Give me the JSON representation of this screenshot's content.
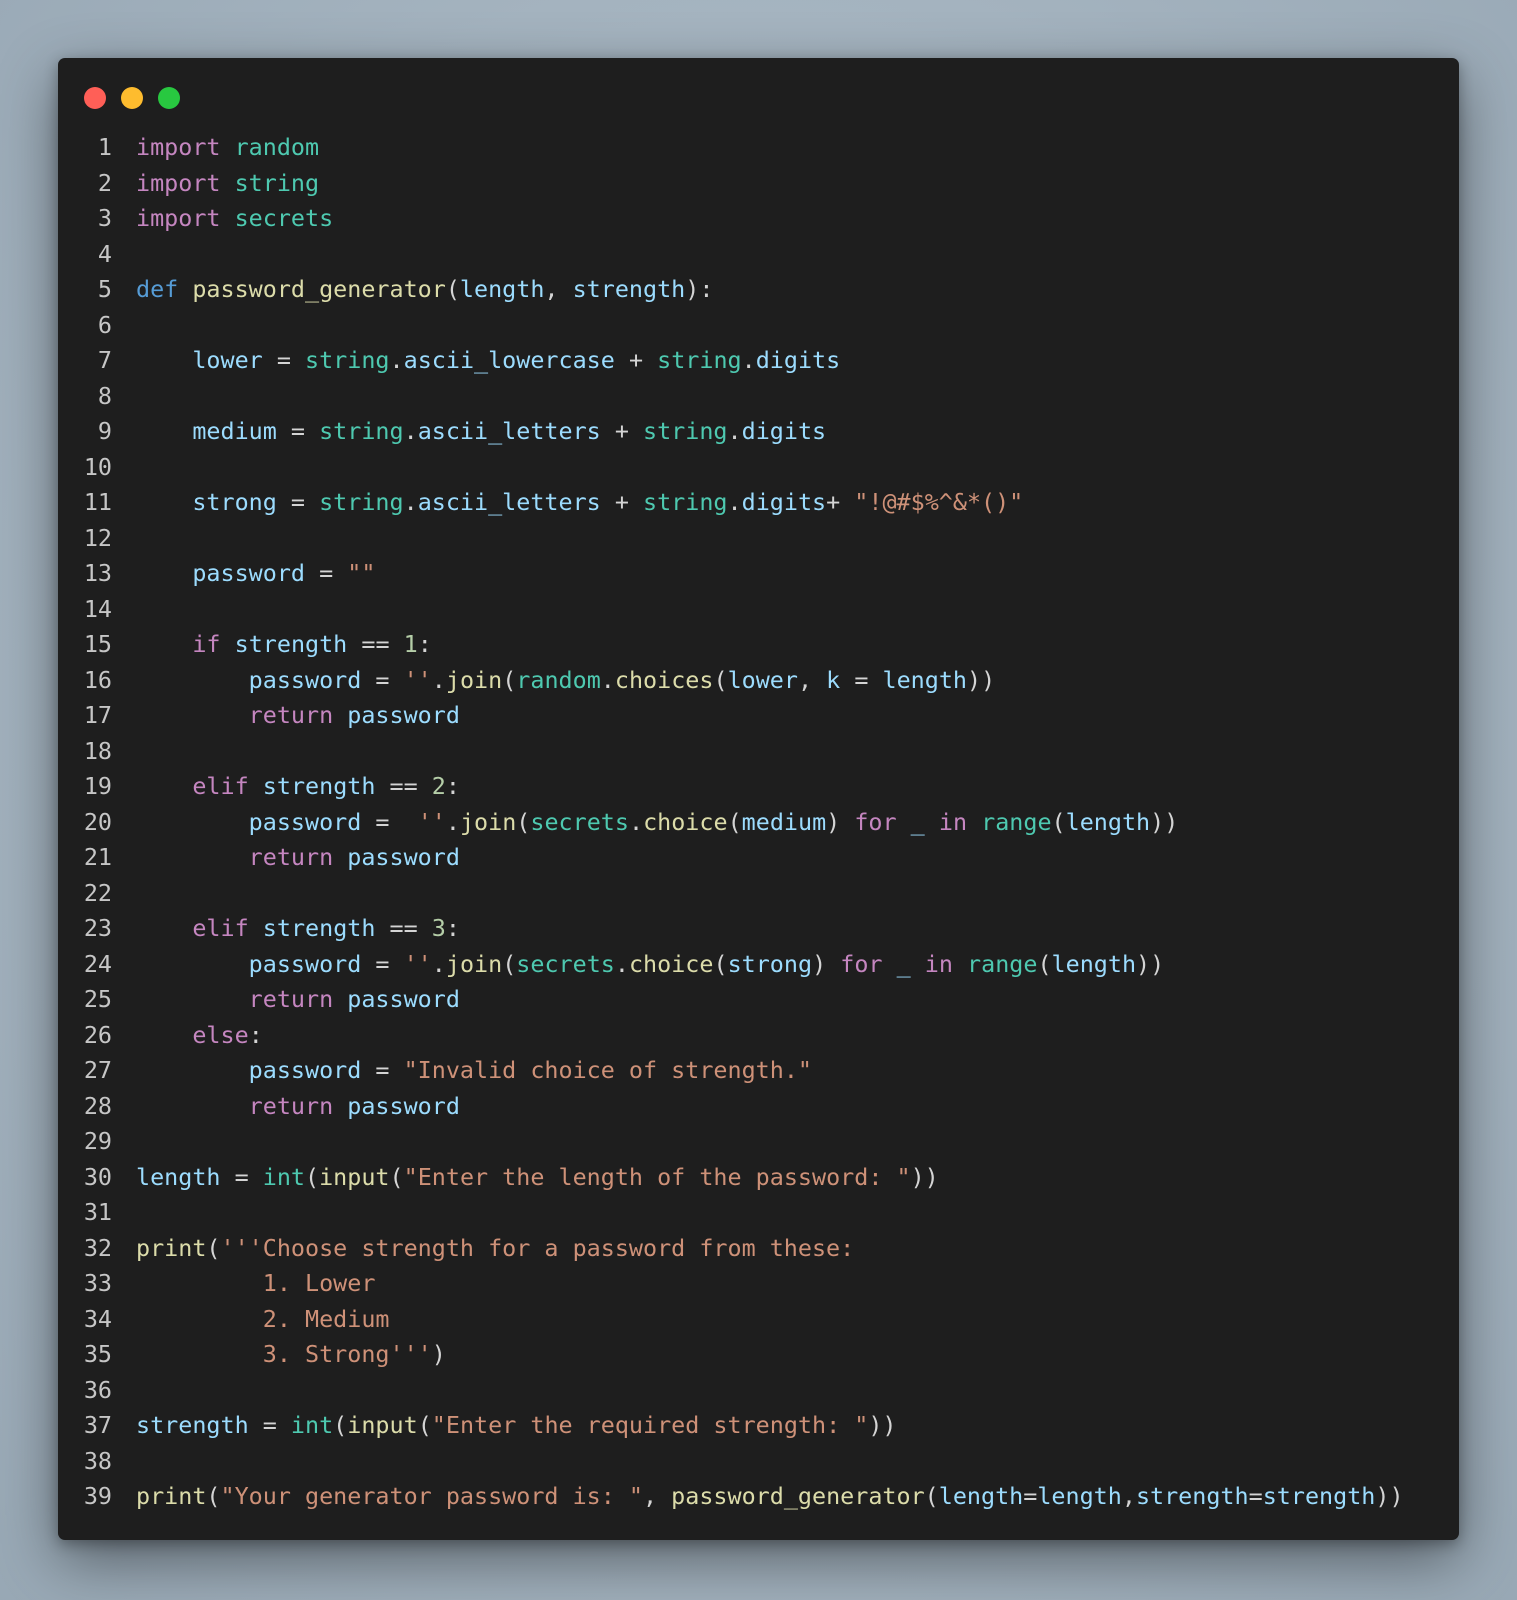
{
  "window": {
    "controls": [
      {
        "name": "close",
        "color": "#ff5f57"
      },
      {
        "name": "minimize",
        "color": "#febc2e"
      },
      {
        "name": "maximize",
        "color": "#28c840"
      }
    ]
  },
  "colors": {
    "background": "#1e1e1e",
    "line_number": "#c6c6c6",
    "keyword": "#c586c0",
    "def_keyword": "#569cd6",
    "module": "#4ec9b0",
    "function": "#dcdcaa",
    "string": "#ce9178",
    "number": "#b5cea8",
    "variable": "#9cdcfe",
    "punctuation": "#d4d4d4"
  },
  "code": {
    "language": "python",
    "lines": [
      [
        [
          "kw",
          "import"
        ],
        [
          "pun",
          " "
        ],
        [
          "mod",
          "random"
        ]
      ],
      [
        [
          "kw",
          "import"
        ],
        [
          "pun",
          " "
        ],
        [
          "mod",
          "string"
        ]
      ],
      [
        [
          "kw",
          "import"
        ],
        [
          "pun",
          " "
        ],
        [
          "mod",
          "secrets"
        ]
      ],
      [],
      [
        [
          "df",
          "def"
        ],
        [
          "pun",
          " "
        ],
        [
          "fn",
          "password_generator"
        ],
        [
          "pun",
          "("
        ],
        [
          "var",
          "length"
        ],
        [
          "pun",
          ", "
        ],
        [
          "var",
          "strength"
        ],
        [
          "pun",
          "):"
        ]
      ],
      [],
      [
        [
          "pun",
          "    "
        ],
        [
          "var",
          "lower"
        ],
        [
          "pun",
          " = "
        ],
        [
          "mod",
          "string"
        ],
        [
          "pun",
          "."
        ],
        [
          "var",
          "ascii_lowercase"
        ],
        [
          "pun",
          " + "
        ],
        [
          "mod",
          "string"
        ],
        [
          "pun",
          "."
        ],
        [
          "var",
          "digits"
        ]
      ],
      [],
      [
        [
          "pun",
          "    "
        ],
        [
          "var",
          "medium"
        ],
        [
          "pun",
          " = "
        ],
        [
          "mod",
          "string"
        ],
        [
          "pun",
          "."
        ],
        [
          "var",
          "ascii_letters"
        ],
        [
          "pun",
          " + "
        ],
        [
          "mod",
          "string"
        ],
        [
          "pun",
          "."
        ],
        [
          "var",
          "digits"
        ]
      ],
      [],
      [
        [
          "pun",
          "    "
        ],
        [
          "var",
          "strong"
        ],
        [
          "pun",
          " = "
        ],
        [
          "mod",
          "string"
        ],
        [
          "pun",
          "."
        ],
        [
          "var",
          "ascii_letters"
        ],
        [
          "pun",
          " + "
        ],
        [
          "mod",
          "string"
        ],
        [
          "pun",
          "."
        ],
        [
          "var",
          "digits"
        ],
        [
          "pun",
          "+ "
        ],
        [
          "str",
          "\"!@#$%^&*()\""
        ]
      ],
      [],
      [
        [
          "pun",
          "    "
        ],
        [
          "var",
          "password"
        ],
        [
          "pun",
          " = "
        ],
        [
          "str",
          "\"\""
        ]
      ],
      [],
      [
        [
          "pun",
          "    "
        ],
        [
          "kw",
          "if"
        ],
        [
          "pun",
          " "
        ],
        [
          "var",
          "strength"
        ],
        [
          "pun",
          " == "
        ],
        [
          "num",
          "1"
        ],
        [
          "pun",
          ":"
        ]
      ],
      [
        [
          "pun",
          "        "
        ],
        [
          "var",
          "password"
        ],
        [
          "pun",
          " = "
        ],
        [
          "str",
          "''"
        ],
        [
          "pun",
          "."
        ],
        [
          "fn",
          "join"
        ],
        [
          "pun",
          "("
        ],
        [
          "mod",
          "random"
        ],
        [
          "pun",
          "."
        ],
        [
          "fn",
          "choices"
        ],
        [
          "pun",
          "("
        ],
        [
          "var",
          "lower"
        ],
        [
          "pun",
          ", "
        ],
        [
          "var",
          "k"
        ],
        [
          "pun",
          " = "
        ],
        [
          "var",
          "length"
        ],
        [
          "pun",
          "))"
        ]
      ],
      [
        [
          "pun",
          "        "
        ],
        [
          "kw",
          "return"
        ],
        [
          "pun",
          " "
        ],
        [
          "var",
          "password"
        ]
      ],
      [],
      [
        [
          "pun",
          "    "
        ],
        [
          "kw",
          "elif"
        ],
        [
          "pun",
          " "
        ],
        [
          "var",
          "strength"
        ],
        [
          "pun",
          " == "
        ],
        [
          "num",
          "2"
        ],
        [
          "pun",
          ":"
        ]
      ],
      [
        [
          "pun",
          "        "
        ],
        [
          "var",
          "password"
        ],
        [
          "pun",
          " =  "
        ],
        [
          "str",
          "''"
        ],
        [
          "pun",
          "."
        ],
        [
          "fn",
          "join"
        ],
        [
          "pun",
          "("
        ],
        [
          "mod",
          "secrets"
        ],
        [
          "pun",
          "."
        ],
        [
          "fn",
          "choice"
        ],
        [
          "pun",
          "("
        ],
        [
          "var",
          "medium"
        ],
        [
          "pun",
          ") "
        ],
        [
          "kw",
          "for"
        ],
        [
          "pun",
          " "
        ],
        [
          "var",
          "_"
        ],
        [
          "pun",
          " "
        ],
        [
          "kw",
          "in"
        ],
        [
          "pun",
          " "
        ],
        [
          "mod",
          "range"
        ],
        [
          "pun",
          "("
        ],
        [
          "var",
          "length"
        ],
        [
          "pun",
          "))"
        ]
      ],
      [
        [
          "pun",
          "        "
        ],
        [
          "kw",
          "return"
        ],
        [
          "pun",
          " "
        ],
        [
          "var",
          "password"
        ]
      ],
      [],
      [
        [
          "pun",
          "    "
        ],
        [
          "kw",
          "elif"
        ],
        [
          "pun",
          " "
        ],
        [
          "var",
          "strength"
        ],
        [
          "pun",
          " == "
        ],
        [
          "num",
          "3"
        ],
        [
          "pun",
          ":"
        ]
      ],
      [
        [
          "pun",
          "        "
        ],
        [
          "var",
          "password"
        ],
        [
          "pun",
          " = "
        ],
        [
          "str",
          "''"
        ],
        [
          "pun",
          "."
        ],
        [
          "fn",
          "join"
        ],
        [
          "pun",
          "("
        ],
        [
          "mod",
          "secrets"
        ],
        [
          "pun",
          "."
        ],
        [
          "fn",
          "choice"
        ],
        [
          "pun",
          "("
        ],
        [
          "var",
          "strong"
        ],
        [
          "pun",
          ") "
        ],
        [
          "kw",
          "for"
        ],
        [
          "pun",
          " "
        ],
        [
          "var",
          "_"
        ],
        [
          "pun",
          " "
        ],
        [
          "kw",
          "in"
        ],
        [
          "pun",
          " "
        ],
        [
          "mod",
          "range"
        ],
        [
          "pun",
          "("
        ],
        [
          "var",
          "length"
        ],
        [
          "pun",
          "))"
        ]
      ],
      [
        [
          "pun",
          "        "
        ],
        [
          "kw",
          "return"
        ],
        [
          "pun",
          " "
        ],
        [
          "var",
          "password"
        ]
      ],
      [
        [
          "pun",
          "    "
        ],
        [
          "kw",
          "else"
        ],
        [
          "pun",
          ":"
        ]
      ],
      [
        [
          "pun",
          "        "
        ],
        [
          "var",
          "password"
        ],
        [
          "pun",
          " = "
        ],
        [
          "str",
          "\"Invalid choice of strength.\""
        ]
      ],
      [
        [
          "pun",
          "        "
        ],
        [
          "kw",
          "return"
        ],
        [
          "pun",
          " "
        ],
        [
          "var",
          "password"
        ]
      ],
      [],
      [
        [
          "var",
          "length"
        ],
        [
          "pun",
          " = "
        ],
        [
          "mod",
          "int"
        ],
        [
          "pun",
          "("
        ],
        [
          "fn",
          "input"
        ],
        [
          "pun",
          "("
        ],
        [
          "str",
          "\"Enter the length of the password: \""
        ],
        [
          "pun",
          "))"
        ]
      ],
      [],
      [
        [
          "fn",
          "print"
        ],
        [
          "pun",
          "("
        ],
        [
          "str",
          "'''Choose strength for a password from these:"
        ]
      ],
      [
        [
          "str",
          "         1. Lower"
        ]
      ],
      [
        [
          "str",
          "         2. Medium"
        ]
      ],
      [
        [
          "str",
          "         3. Strong'''"
        ],
        [
          "pun",
          ")"
        ]
      ],
      [],
      [
        [
          "var",
          "strength"
        ],
        [
          "pun",
          " = "
        ],
        [
          "mod",
          "int"
        ],
        [
          "pun",
          "("
        ],
        [
          "fn",
          "input"
        ],
        [
          "pun",
          "("
        ],
        [
          "str",
          "\"Enter the required strength: \""
        ],
        [
          "pun",
          "))"
        ]
      ],
      [],
      [
        [
          "fn",
          "print"
        ],
        [
          "pun",
          "("
        ],
        [
          "str",
          "\"Your generator password is: \""
        ],
        [
          "pun",
          ", "
        ],
        [
          "fn",
          "password_generator"
        ],
        [
          "pun",
          "("
        ],
        [
          "var",
          "length"
        ],
        [
          "pun",
          "="
        ],
        [
          "var",
          "length"
        ],
        [
          "pun",
          ","
        ],
        [
          "var",
          "strength"
        ],
        [
          "pun",
          "="
        ],
        [
          "var",
          "strength"
        ],
        [
          "pun",
          "))"
        ]
      ]
    ]
  }
}
